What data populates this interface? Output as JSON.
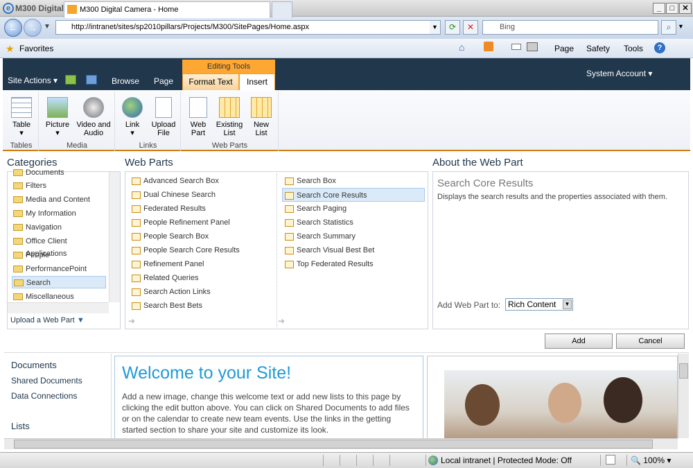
{
  "window": {
    "title": "M300 Digital Camera - Home - Windows Internet Explorer",
    "min": "_",
    "max": "□",
    "close": "✕"
  },
  "address": {
    "url": "http://intranet/sites/sp2010pillars/Projects/M300/SitePages/Home.aspx",
    "search_placeholder": "Bing"
  },
  "favorites": {
    "label": "Favorites",
    "tab_title": "M300 Digital Camera - Home",
    "commands": [
      "Page",
      "Safety",
      "Tools"
    ]
  },
  "ribbon": {
    "site_actions": "Site Actions",
    "editing_tools": "Editing Tools",
    "tabs": [
      "Browse",
      "Page",
      "Format Text",
      "Insert"
    ],
    "system_account": "System Account",
    "groups": [
      {
        "label": "Tables",
        "buttons": [
          "Table"
        ]
      },
      {
        "label": "Media",
        "buttons": [
          "Picture",
          "Video and Audio"
        ]
      },
      {
        "label": "Links",
        "buttons": [
          "Link",
          "Upload File"
        ]
      },
      {
        "label": "Web Parts",
        "buttons": [
          "Web Part",
          "Existing List",
          "New List"
        ]
      }
    ]
  },
  "picker": {
    "categories_title": "Categories",
    "categories": [
      "Documents",
      "Filters",
      "Media and Content",
      "My Information",
      "Navigation",
      "Office Client Applications",
      "People",
      "PerformancePoint",
      "Search",
      "Miscellaneous"
    ],
    "selected_category": "Search",
    "upload": "Upload a Web Part",
    "webparts_title": "Web Parts",
    "webparts_col1": [
      "Advanced Search Box",
      "Dual Chinese Search",
      "Federated Results",
      "People Refinement Panel",
      "People Search Box",
      "People Search Core Results",
      "Refinement Panel",
      "Related Queries",
      "Search Action Links",
      "Search Best Bets"
    ],
    "webparts_col2": [
      "Search Box",
      "Search Core Results",
      "Search Paging",
      "Search Statistics",
      "Search Summary",
      "Search Visual Best Bet",
      "Top Federated Results"
    ],
    "selected_webpart": "Search Core Results",
    "about_title": "About the Web Part",
    "about_name": "Search Core Results",
    "about_desc": "Displays the search results and the properties associated with them.",
    "add_to_label": "Add Web Part to:",
    "add_to_value": "Rich Content",
    "add_button": "Add",
    "cancel_button": "Cancel"
  },
  "quicklaunch": {
    "documents": "Documents",
    "shared": "Shared Documents",
    "data": "Data Connections",
    "lists": "Lists"
  },
  "welcome": {
    "title": "Welcome to your Site!",
    "body": "Add a new image, change this welcome text or add new lists to this page by clicking the edit button above. You can click on Shared Documents to add files or on the calendar to create new team events. Use the links in the getting started section to share your site and customize its look."
  },
  "status": {
    "zone": "Local intranet | Protected Mode: Off",
    "zoom": "100%"
  }
}
